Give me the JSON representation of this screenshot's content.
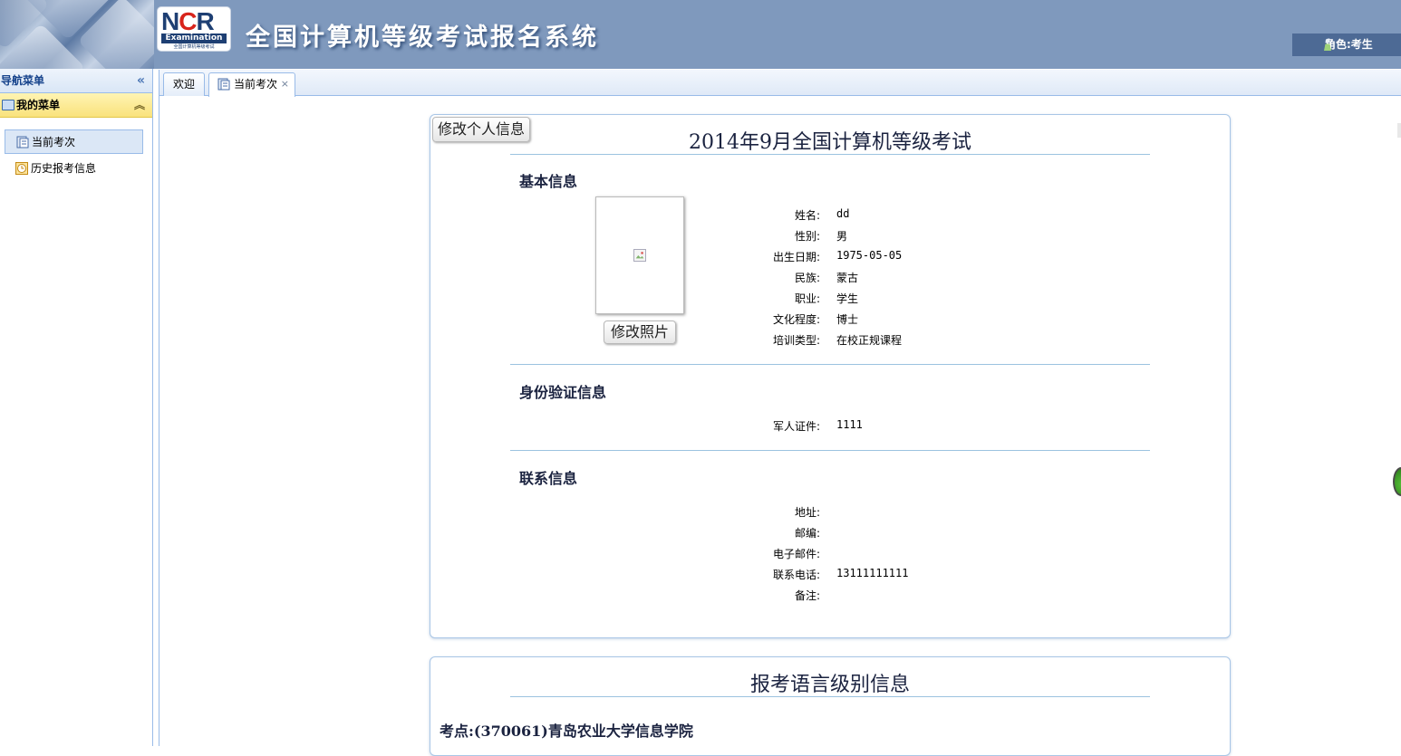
{
  "header": {
    "logo_text": "NCR",
    "logo_sub": "Examination",
    "logo_caption": "全国计算机等级考试",
    "system_title": "全国计算机等级考试报名系统",
    "role_label": "角色:考生"
  },
  "sidebar": {
    "title": "导航菜单",
    "menu_title": "我的菜单",
    "items": [
      {
        "label": "当前考次",
        "icon": "document-icon",
        "active": true
      },
      {
        "label": "历史报考信息",
        "icon": "clock-icon",
        "active": false
      }
    ]
  },
  "tabs": [
    {
      "label": "欢迎"
    },
    {
      "label": "当前考次",
      "closable": true
    }
  ],
  "exam": {
    "edit_info_button": "修改个人信息",
    "title": "2014年9月全国计算机等级考试",
    "edit_photo_button": "修改照片",
    "basic": {
      "section_title": "基本信息",
      "fields": [
        {
          "label": "姓名:",
          "value": "dd"
        },
        {
          "label": "性别:",
          "value": "男"
        },
        {
          "label": "出生日期:",
          "value": "1975-05-05"
        },
        {
          "label": "民族:",
          "value": "蒙古"
        },
        {
          "label": "职业:",
          "value": "学生"
        },
        {
          "label": "文化程度:",
          "value": "博士"
        },
        {
          "label": "培训类型:",
          "value": "在校正规课程"
        }
      ]
    },
    "identity": {
      "section_title": "身份验证信息",
      "fields": [
        {
          "label": "军人证件:",
          "value": "1111"
        }
      ]
    },
    "contact": {
      "section_title": "联系信息",
      "fields": [
        {
          "label": "地址:",
          "value": ""
        },
        {
          "label": "邮编:",
          "value": ""
        },
        {
          "label": "电子邮件:",
          "value": ""
        },
        {
          "label": "联系电话:",
          "value": "13111111111"
        },
        {
          "label": "备注:",
          "value": ""
        }
      ]
    }
  },
  "language": {
    "title": "报考语言级别信息",
    "exam_site": "考点:(370061)青岛农业大学信息学院"
  },
  "colors": {
    "header_bg": "#7f99bd",
    "role_bg": "#4d6a95",
    "menu_head": "#f9e27c",
    "border": "#99bbe8"
  }
}
